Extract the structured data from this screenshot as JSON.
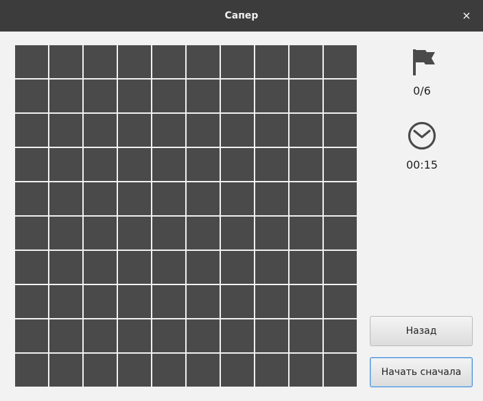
{
  "window": {
    "title": "Сапер",
    "close_glyph": "×"
  },
  "board": {
    "rows": 10,
    "cols": 10,
    "cell_state": "closed",
    "cell_color": "#4a4a4a"
  },
  "status": {
    "flag_icon": "flag-icon",
    "flags": "0/6",
    "clock_icon": "clock-icon",
    "time": "00:15"
  },
  "buttons": {
    "back_label": "Назад",
    "restart_label": "Начать сначала"
  },
  "colors": {
    "titlebar": "#3c3c3c",
    "background": "#f2f2f2",
    "icon": "#4a4a4a",
    "focus_border": "#4a90d9"
  }
}
